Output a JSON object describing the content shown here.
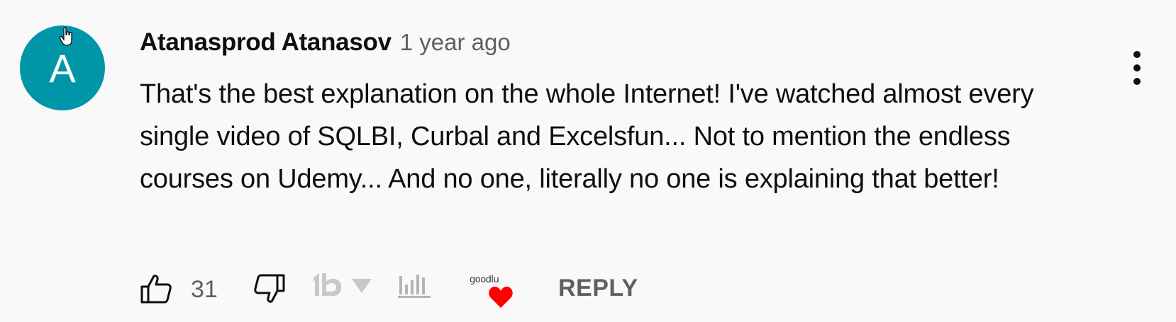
{
  "comment": {
    "avatar_letter": "A",
    "avatar_color": "#0096a8",
    "author": "Atanasprod Atanasov",
    "time": "1 year ago",
    "text": "That's the best explanation on the whole Internet! I've watched almost every single video of SQLBI, Curbal and Excelsfun... Not to mention the endless courses on Udemy... And no one, literally no one is explaining that better!",
    "menu_icon": "more-vertical-icon"
  },
  "actions": {
    "like_icon": "thumbs-up-icon",
    "like_count": "31",
    "dislike_icon": "thumbs-down-icon",
    "extension_tb_icon": "tb-logo-icon",
    "extension_caret_icon": "caret-down-icon",
    "extension_chart_icon": "bar-chart-icon",
    "extension_goodlu_text": "goodlu",
    "extension_heart_color": "#ff0000",
    "reply_label": "REPLY"
  }
}
